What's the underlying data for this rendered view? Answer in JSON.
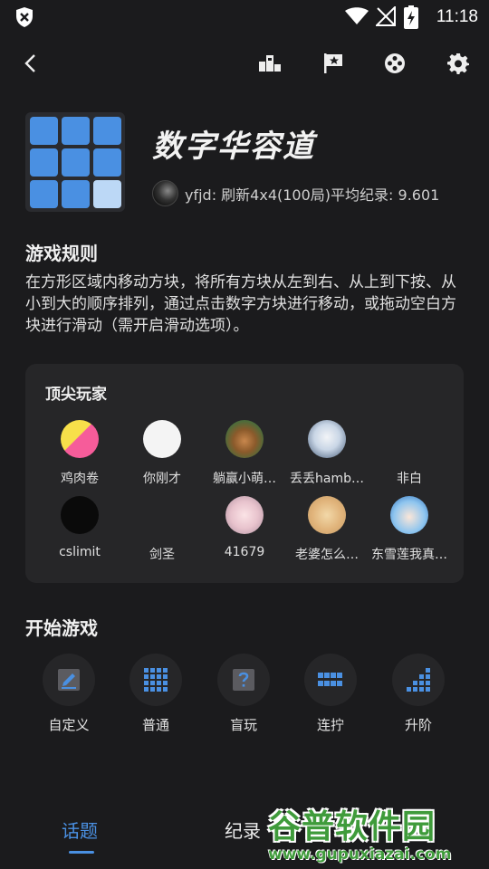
{
  "status_bar": {
    "time": "11:18"
  },
  "toolbar": {
    "back_icon": "arrow-left-icon",
    "icons": [
      "leaderboard-icon",
      "flag-icon",
      "game-controller-icon",
      "gear-icon"
    ]
  },
  "game": {
    "title": "数字华容道",
    "record": "yfjd: 刷新4x4(100局)平均纪录: 9.601"
  },
  "rules": {
    "heading": "游戏规则",
    "text": "在方形区域内移动方块，将所有方块从左到右、从上到下按、从小到大的顺序排列，通过点击数字方块进行移动，或拖动空白方块进行滑动（需开启滑动选项）。"
  },
  "top_players": {
    "heading": "顶尖玩家",
    "players": [
      {
        "name": "鸡肉卷"
      },
      {
        "name": "你刚才"
      },
      {
        "name": "躺赢小萌…"
      },
      {
        "name": "丢丢hamb…"
      },
      {
        "name": "非白"
      },
      {
        "name": "cslimit"
      },
      {
        "name": "剑圣"
      },
      {
        "name": "41679"
      },
      {
        "name": "老婆怎么…"
      },
      {
        "name": "东雪莲我真…"
      }
    ]
  },
  "start_game": {
    "heading": "开始游戏",
    "modes": [
      {
        "label": "自定义",
        "icon": "pencil-icon"
      },
      {
        "label": "普通",
        "icon": "grid-icon"
      },
      {
        "label": "盲玩",
        "icon": "question-grid-icon"
      },
      {
        "label": "连拧",
        "icon": "stack-icon"
      },
      {
        "label": "升阶",
        "icon": "stairs-icon"
      }
    ]
  },
  "tabs": [
    "话题",
    "纪录"
  ],
  "watermark": {
    "line1": "谷普软件园",
    "line2": "www.gupuxiazai.com"
  },
  "colors": {
    "accent": "#4a90e2",
    "background": "#1b1b1d",
    "card": "#262628"
  }
}
